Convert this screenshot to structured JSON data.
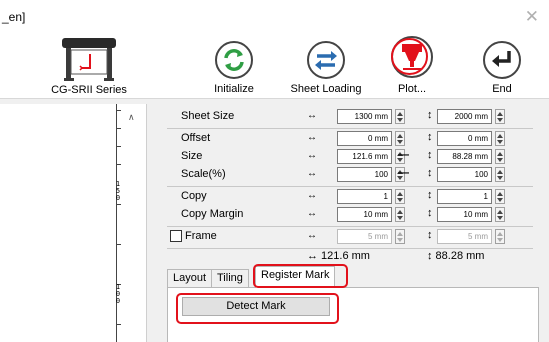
{
  "window": {
    "title": "_en]",
    "close_symbol": "✕"
  },
  "toolbar": {
    "plotter_label": "CG-SRII Series",
    "initialize_label": "Initialize",
    "sheet_loading_label": "Sheet Loading",
    "plot_label": "Plot...",
    "end_label": "End"
  },
  "preview": {
    "ruler_labels": [
      {
        "chars": [
          "1",
          "5",
          "0"
        ]
      },
      {
        "chars": [
          "1",
          "0",
          "0"
        ]
      }
    ]
  },
  "settings": {
    "rows": [
      {
        "name": "Sheet Size",
        "w": "1300 mm",
        "h": "2000 mm",
        "linked": false,
        "disabled": false
      },
      {
        "name": "Offset",
        "w": "0 mm",
        "h": "0 mm",
        "linked": false,
        "disabled": false
      },
      {
        "name": "Size",
        "w": "121.6 mm",
        "h": "88.28 mm",
        "linked": true,
        "disabled": false
      },
      {
        "name": "Scale(%)",
        "w": "100",
        "h": "100",
        "linked": true,
        "disabled": false
      },
      {
        "name": "Copy",
        "w": "1",
        "h": "1",
        "linked": false,
        "disabled": false
      },
      {
        "name": "Copy Margin",
        "w": "10 mm",
        "h": "10 mm",
        "linked": false,
        "disabled": false
      },
      {
        "name": "Frame",
        "w": "5 mm",
        "h": "5 mm",
        "linked": false,
        "disabled": true
      }
    ],
    "summary_w": "↔ 121.6 mm",
    "summary_h": "↕ 88.28 mm",
    "frame_checked": false
  },
  "tabs": [
    {
      "label": "Layout",
      "active": false
    },
    {
      "label": "Tiling",
      "active": false
    },
    {
      "label": "Register Mark",
      "active": true
    }
  ],
  "register_mark": {
    "detect_button": "Detect Mark"
  },
  "colors": {
    "highlight": "#e2111b",
    "icon_blue": "#2b6cb0",
    "icon_green": "#2f9e44",
    "plot_red": "#e2111b"
  }
}
